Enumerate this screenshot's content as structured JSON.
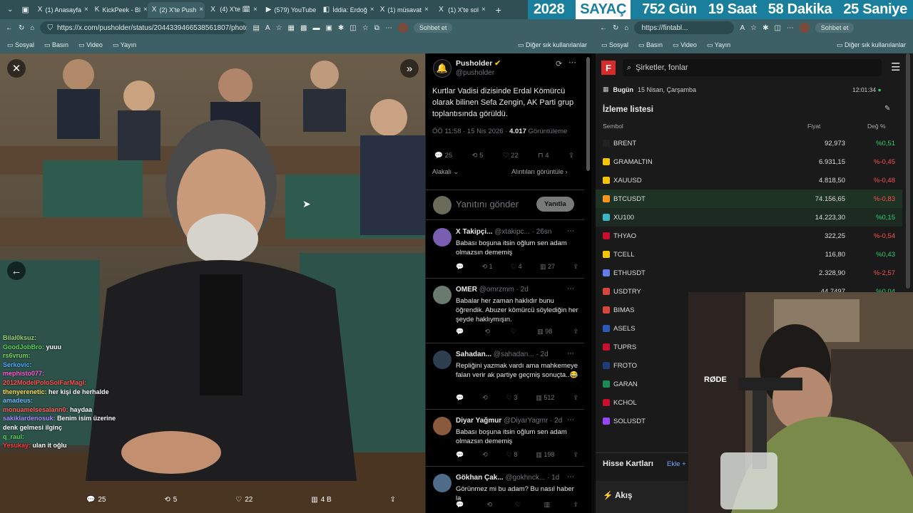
{
  "tabs": [
    {
      "label": "(1) Anasayfa",
      "icon": "X"
    },
    {
      "label": "KickPeek - Bl",
      "icon": "K"
    },
    {
      "label": "(2) X'te Push",
      "icon": "X",
      "active": true
    },
    {
      "label": "(4) X'te 🗓",
      "icon": "X"
    },
    {
      "label": "(579) YouTube",
      "icon": "▶"
    },
    {
      "label": "İddia: Erdoğ",
      "icon": "◧"
    },
    {
      "label": "(1) müsavat",
      "icon": "X"
    },
    {
      "label": "(1) X'te sol",
      "icon": "X"
    }
  ],
  "counter": {
    "year": "2028",
    "label": "SAYAÇ",
    "days": "752 Gün",
    "hours": "19 Saat",
    "minutes": "58 Dakika",
    "seconds": "25 Saniye"
  },
  "left_url": "https://x.com/pusholder/status/2044339466538561807/photo/2",
  "right_url": "https://fintabl...",
  "sohbet": "Sohbet et",
  "bookmarks": [
    "Sosyal",
    "Basın",
    "Video",
    "Yayın"
  ],
  "bookmarks_other": "Diğer sık kullanılanlar",
  "photo_actions": {
    "replies": "25",
    "reposts": "5",
    "likes": "22",
    "views": "4 B"
  },
  "chat": [
    {
      "user": "Bilal0ksuz:",
      "msg": "",
      "color": "#9bd27a"
    },
    {
      "user": "GoodJobBro:",
      "msg": "yuuu",
      "color": "#5bd15b"
    },
    {
      "user": "rs6vrum:",
      "msg": "",
      "color": "#7fd36a"
    },
    {
      "user": "Serkovic:",
      "msg": "",
      "color": "#4aa8ff"
    },
    {
      "user": "mephisto077:",
      "msg": "",
      "color": "#ff5ad6"
    },
    {
      "user": "2012ModelPoloSolFarMagi:",
      "msg": "",
      "color": "#ff5050"
    },
    {
      "user": "thenyerenetic:",
      "msg": "her kişi de herhalde",
      "color": "#ffd84a"
    },
    {
      "user": "amadeus:",
      "msg": "",
      "color": "#6fb4ff"
    },
    {
      "user": "monuamelsesalann0:",
      "msg": "haydaa",
      "color": "#ff5a5a"
    },
    {
      "user": "sakiklardenosuk:",
      "msg": "Benim isim üzerine denk gelmesi ilginç",
      "color": "#a98cff"
    },
    {
      "user": "q_raul:",
      "msg": "",
      "color": "#5bd15b"
    },
    {
      "user": "Yesukay:",
      "msg": "ulan it oğlu",
      "color": "#ff3a3a"
    }
  ],
  "main_tweet": {
    "name": "Pusholder",
    "handle": "@pusholder",
    "text": "Kurtlar Vadisi dizisinde Erdal Kömürcü olarak bilinen Sefa Zengin, AK Parti grup toplantısında görüldü.",
    "meta": "ÖÖ 11:58 · 15 Nis 2026 ·",
    "views": "4.017",
    "views_label": "Görüntüleme",
    "replies": "25",
    "reposts": "5",
    "likes": "22",
    "bookmarks": "4",
    "related": "Alakalı",
    "quotes": "Alıntıları görüntüle",
    "reply_placeholder": "Yanıtını gönder",
    "reply_button": "Yanıtla"
  },
  "replies": [
    {
      "name": "X Takipçi...",
      "handle": "@xtakipc...",
      "time": "26sn",
      "text": "Babası boşuna itsin oğlum sen adam olmazsın dememiş",
      "r": "",
      "rt": "1",
      "l": "4",
      "v": "27",
      "avatar": "#7a5fb0"
    },
    {
      "name": "ÖMER",
      "handle": "@omrzmm",
      "time": "2d",
      "text": "Babalar her zaman haklıdır bunu öğrendik. Abuzer kömürcü söylediğin her şeyde haklıymışın.",
      "r": "",
      "rt": "",
      "l": "",
      "v": "98",
      "avatar": "#6b7a6e"
    },
    {
      "name": "Sahadan...",
      "handle": "@sahadan...",
      "time": "2d",
      "text": "Repliğini yazmak vardı ama mahkemeye falan verir ak partiye geçmiş sonuçta..😂",
      "r": "",
      "rt": "",
      "l": "3",
      "v": "512",
      "avatar": "#2c3e50"
    },
    {
      "name": "Diyar Yağmur",
      "handle": "@DiyarYagmr",
      "time": "2d",
      "text": "Babası boşuna itsin oğlum sen adam olmazsın dememiş",
      "r": "",
      "rt": "",
      "l": "8",
      "v": "198",
      "avatar": "#8a5a3c"
    },
    {
      "name": "Gökhan Çak...",
      "handle": "@gokhnck...",
      "time": "1d",
      "text": "Görünmez mi bu adam? Bu nasıl haber la",
      "r": "",
      "rt": "",
      "l": "",
      "v": "",
      "avatar": "#4e6b8a"
    }
  ],
  "fin": {
    "search_placeholder": "Şirketler, fonlar",
    "today": "Bugün",
    "date": "15 Nisan, Çarşamba",
    "clock": "12:01:34",
    "watchlist": "İzleme listesi",
    "col_symbol": "Sembol",
    "col_price": "Fiyat",
    "col_change": "Değ %",
    "rows": [
      {
        "sym": "BRENT",
        "price": "92,973",
        "chg": "%0,51",
        "pos": true,
        "color": "#222"
      },
      {
        "sym": "GRAMALTIN",
        "price": "6.931,15",
        "chg": "%-0,45",
        "pos": false,
        "color": "#f5c400"
      },
      {
        "sym": "XAUUSD",
        "price": "4.818,50",
        "chg": "%-0,48",
        "pos": false,
        "color": "#f5c400"
      },
      {
        "sym": "BTCUSDT",
        "price": "74.156,65",
        "chg": "%-0,83",
        "pos": false,
        "color": "#f7931a"
      },
      {
        "sym": "XU100",
        "price": "14.223,30",
        "chg": "%0,15",
        "pos": true,
        "color": "#3bb6c8"
      },
      {
        "sym": "THYAO",
        "price": "322,25",
        "chg": "%-0,54",
        "pos": false,
        "color": "#c8102e"
      },
      {
        "sym": "TCELL",
        "price": "116,80",
        "chg": "%0,43",
        "pos": true,
        "color": "#f5c400"
      },
      {
        "sym": "ETHUSDT",
        "price": "2.328,90",
        "chg": "%-2,57",
        "pos": false,
        "color": "#627eea"
      },
      {
        "sym": "USDTRY",
        "price": "44,7497",
        "chg": "%0,04",
        "pos": true,
        "color": "#d8453a"
      },
      {
        "sym": "BIMAS",
        "price": "",
        "chg": "",
        "pos": true,
        "color": "#d8453a"
      },
      {
        "sym": "ASELS",
        "price": "",
        "chg": "",
        "pos": true,
        "color": "#2a5ab8"
      },
      {
        "sym": "TUPRS",
        "price": "",
        "chg": "",
        "pos": true,
        "color": "#c8102e"
      },
      {
        "sym": "FROTO",
        "price": "",
        "chg": "",
        "pos": true,
        "color": "#1f3b7a"
      },
      {
        "sym": "GARAN",
        "price": "",
        "chg": "",
        "pos": true,
        "color": "#1b8a5a"
      },
      {
        "sym": "KCHOL",
        "price": "",
        "chg": "",
        "pos": true,
        "color": "#c8102e"
      },
      {
        "sym": "SOLUSDT",
        "price": "",
        "chg": "",
        "pos": true,
        "color": "#9945ff"
      }
    ],
    "cards": "Hisse Kartları",
    "cards_add": "Ekle",
    "flow": "Akış"
  },
  "rode": "RØDE"
}
